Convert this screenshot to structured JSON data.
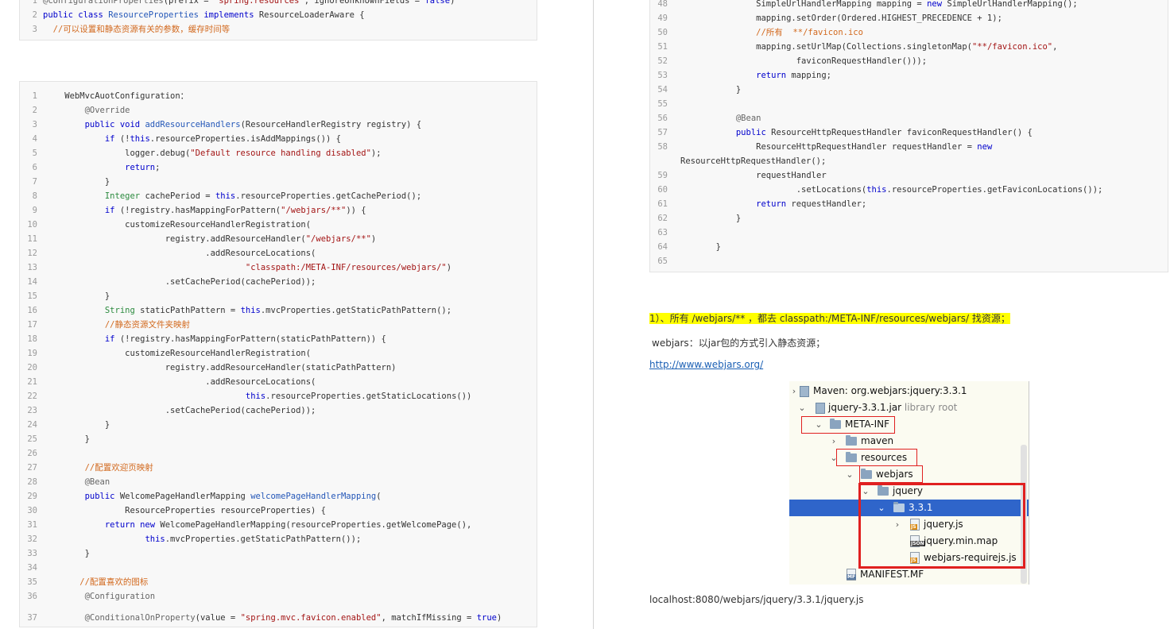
{
  "top_code": {
    "lines": [
      {
        "n": "1",
        "html": "<span class=\"an\">@ConfigurationProperties</span>(prefix = <span class=\"str\">\"spring.resources\"</span>, ignoreUnknownFields = <span class=\"kw\">false</span>)"
      },
      {
        "n": "2",
        "html": "<span class=\"kw\">public class</span> <span class=\"fn\">ResourceProperties</span> <span class=\"kw\">implements</span> ResourceLoaderAware {"
      },
      {
        "n": "3",
        "html": "  <span class=\"cm\">//可以设置和静态资源有关的参数，缓存时间等</span>"
      }
    ]
  },
  "main_code": {
    "lines": [
      {
        "n": "1",
        "html": "    WebMvcAuotConfiguration："
      },
      {
        "n": "2",
        "html": "        <span class=\"an\">@Override</span>"
      },
      {
        "n": "3",
        "html": "        <span class=\"kw\">public void</span> <span class=\"fn\">addResourceHandlers</span>(ResourceHandlerRegistry registry) {"
      },
      {
        "n": "4",
        "html": "            <span class=\"kw\">if</span> (!<span class=\"kw\">this</span>.resourceProperties.isAddMappings()) {"
      },
      {
        "n": "5",
        "html": "                logger.debug(<span class=\"str\">\"Default resource handling disabled\"</span>);"
      },
      {
        "n": "6",
        "html": "                <span class=\"kw\">return</span>;"
      },
      {
        "n": "7",
        "html": "            }"
      },
      {
        "n": "8",
        "html": "            <span class=\"ty\">Integer</span> cachePeriod = <span class=\"kw\">this</span>.resourceProperties.getCachePeriod();"
      },
      {
        "n": "9",
        "html": "            <span class=\"kw\">if</span> (!registry.hasMappingForPattern(<span class=\"str\">\"/webjars/**\"</span>)) {"
      },
      {
        "n": "10",
        "html": "                customizeResourceHandlerRegistration("
      },
      {
        "n": "11",
        "html": "                        registry.addResourceHandler(<span class=\"str\">\"/webjars/**\"</span>)"
      },
      {
        "n": "12",
        "html": "                                .addResourceLocations("
      },
      {
        "n": "13",
        "html": "                                        <span class=\"str\">\"classpath:/META-INF/resources/webjars/\"</span>)"
      },
      {
        "n": "14",
        "html": "                        .setCachePeriod(cachePeriod));"
      },
      {
        "n": "15",
        "html": "            }"
      },
      {
        "n": "16",
        "html": "            <span class=\"ty\">String</span> staticPathPattern = <span class=\"kw\">this</span>.mvcProperties.getStaticPathPattern();"
      },
      {
        "n": "17",
        "html": "            <span class=\"cm\">//静态资源文件夹映射</span>"
      },
      {
        "n": "18",
        "html": "            <span class=\"kw\">if</span> (!registry.hasMappingForPattern(staticPathPattern)) {"
      },
      {
        "n": "19",
        "html": "                customizeResourceHandlerRegistration("
      },
      {
        "n": "20",
        "html": "                        registry.addResourceHandler(staticPathPattern)"
      },
      {
        "n": "21",
        "html": "                                .addResourceLocations("
      },
      {
        "n": "22",
        "html": "                                        <span class=\"kw\">this</span>.resourceProperties.getStaticLocations())"
      },
      {
        "n": "23",
        "html": "                        .setCachePeriod(cachePeriod));"
      },
      {
        "n": "24",
        "html": "            }"
      },
      {
        "n": "25",
        "html": "        }"
      },
      {
        "n": "26",
        "html": ""
      },
      {
        "n": "27",
        "html": "        <span class=\"cm\">//配置欢迎页映射</span>"
      },
      {
        "n": "28",
        "html": "        <span class=\"an\">@Bean</span>"
      },
      {
        "n": "29",
        "html": "        <span class=\"kw\">public</span> WelcomePageHandlerMapping <span class=\"fn\">welcomePageHandlerMapping</span>("
      },
      {
        "n": "30",
        "html": "                ResourceProperties resourceProperties) {"
      },
      {
        "n": "31",
        "html": "            <span class=\"kw\">return new</span> WelcomePageHandlerMapping(resourceProperties.getWelcomePage(),"
      },
      {
        "n": "32",
        "html": "                    <span class=\"kw\">this</span>.mvcProperties.getStaticPathPattern());"
      },
      {
        "n": "33",
        "html": "        }"
      },
      {
        "n": "34",
        "html": ""
      },
      {
        "n": "35",
        "html": "       <span class=\"cm\">//配置喜欢的图标</span>"
      },
      {
        "n": "36",
        "html": "        <span class=\"an\">@Configuration</span>"
      },
      {
        "n": "37",
        "html": "        <span class=\"an\">@ConditionalOnProperty</span>(value = <span class=\"str\">\"spring.mvc.favicon.enabled\"</span>, matchIfMissing = <span class=\"kw\">true</span>)"
      }
    ]
  },
  "right_code": {
    "lines": [
      {
        "n": "48",
        "html": "                SimpleUrlHandlerMapping mapping = <span class=\"kw\">new</span> SimpleUrlHandlerMapping();"
      },
      {
        "n": "49",
        "html": "                mapping.setOrder(Ordered.HIGHEST_PRECEDENCE + 1);"
      },
      {
        "n": "50",
        "html": "                <span class=\"cm\">//所有  **/favicon.ico</span>"
      },
      {
        "n": "51",
        "html": "                mapping.setUrlMap(Collections.singletonMap(<span class=\"str\">\"**/favicon.ico\"</span>,"
      },
      {
        "n": "52",
        "html": "                        faviconRequestHandler()));"
      },
      {
        "n": "53",
        "html": "                <span class=\"kw\">return</span> mapping;"
      },
      {
        "n": "54",
        "html": "            }"
      },
      {
        "n": "55",
        "html": ""
      },
      {
        "n": "56",
        "html": "            <span class=\"an\">@Bean</span>"
      },
      {
        "n": "57",
        "html": "            <span class=\"kw\">public</span> ResourceHttpRequestHandler faviconRequestHandler() {"
      },
      {
        "n": "58",
        "html": "                ResourceHttpRequestHandler requestHandler = <span class=\"kw\">new</span>"
      },
      {
        "n": "",
        "html": "ResourceHttpRequestHandler();"
      },
      {
        "n": "59",
        "html": "                requestHandler"
      },
      {
        "n": "60",
        "html": "                        .setLocations(<span class=\"kw\">this</span>.resourceProperties.getFaviconLocations());"
      },
      {
        "n": "61",
        "html": "                <span class=\"kw\">return</span> requestHandler;"
      },
      {
        "n": "62",
        "html": "            }"
      },
      {
        "n": "63",
        "html": ""
      },
      {
        "n": "64",
        "html": "        }"
      },
      {
        "n": "65",
        "html": ""
      }
    ]
  },
  "notes": {
    "highlight": "1）、所有 /webjars/** ，都去 classpath:/META-INF/resources/webjars/ 找资源；",
    "webjars_desc": "webjars：以jar包的方式引入静态资源；",
    "webjars_link": "http://www.webjars.org/",
    "url_example": "localhost:8080/webjars/jquery/3.3.1/jquery.js"
  },
  "tree": {
    "maven": "Maven: org.webjars:jquery:3.3.1",
    "jar": "jquery-3.3.1.jar",
    "jar_suffix": "library root",
    "meta_inf": "META-INF",
    "maven_dir": "maven",
    "resources": "resources",
    "webjars": "webjars",
    "jquery": "jquery",
    "version": "3.3.1",
    "jquery_js": "jquery.js",
    "jquery_map": "jquery.min.map",
    "requirejs": "webjars-requirejs.js",
    "manifest": "MANIFEST.MF"
  }
}
